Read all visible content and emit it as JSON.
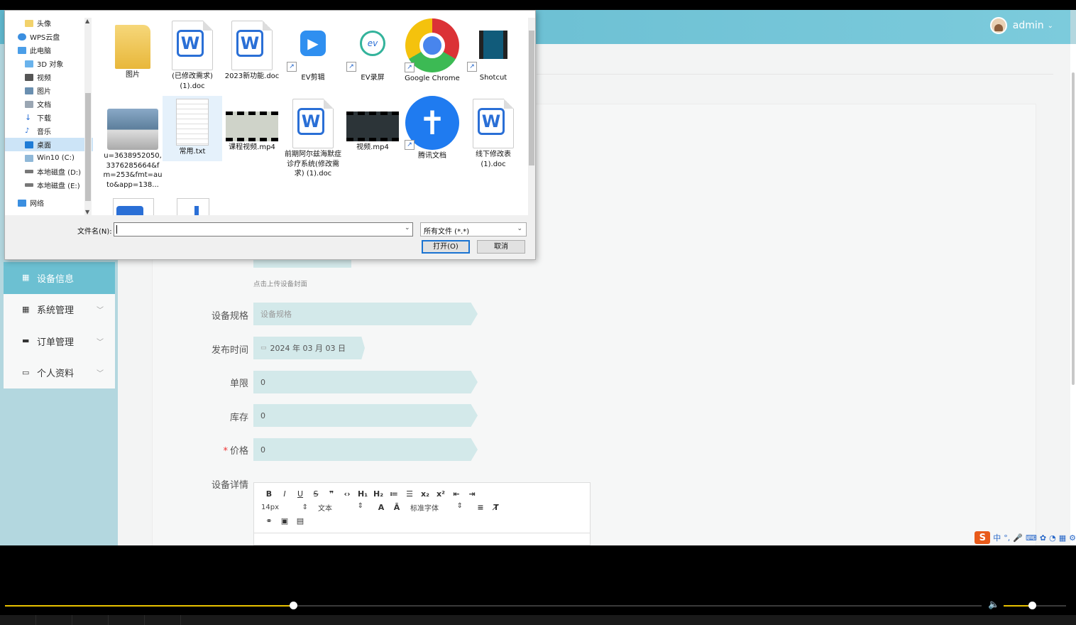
{
  "header": {
    "username": "admin"
  },
  "sidebar": {
    "items": [
      {
        "label": "设备信息",
        "active": true
      },
      {
        "label": "系统管理"
      },
      {
        "label": "订单管理"
      },
      {
        "label": "个人资料"
      }
    ]
  },
  "form": {
    "upload_hint": "点击上传设备封面",
    "spec_label": "设备规格",
    "spec_placeholder": "设备规格",
    "date_label": "发布时间",
    "date_value": "2024 年 03 月 03 日",
    "limit_label": "单限",
    "limit_value": "0",
    "stock_label": "库存",
    "stock_value": "0",
    "price_label": "价格",
    "price_value": "0",
    "detail_label": "设备详情",
    "editor": {
      "font_size": "14px",
      "block_type": "文本",
      "font_family": "标准字体"
    }
  },
  "dialog": {
    "nav": [
      {
        "label": "头像",
        "icon": "folder-icon"
      },
      {
        "label": "WPS云盘",
        "icon": "cloud-icon"
      },
      {
        "label": "此电脑",
        "icon": "computer-icon"
      },
      {
        "label": "3D 对象",
        "icon": "3d-icon"
      },
      {
        "label": "视频",
        "icon": "video-folder-icon"
      },
      {
        "label": "图片",
        "icon": "pictures-folder-icon"
      },
      {
        "label": "文档",
        "icon": "documents-folder-icon"
      },
      {
        "label": "下载",
        "icon": "download-icon"
      },
      {
        "label": "音乐",
        "icon": "music-icon"
      },
      {
        "label": "桌面",
        "icon": "desktop-icon",
        "selected": true
      },
      {
        "label": "Win10 (C:)",
        "icon": "drive-icon"
      },
      {
        "label": "本地磁盘 (D:)",
        "icon": "drive-icon"
      },
      {
        "label": "本地磁盘 (E:)",
        "icon": "drive-icon"
      },
      {
        "label": "网络",
        "icon": "network-icon"
      }
    ],
    "files": [
      {
        "name": "图片",
        "icon": "folder-icon"
      },
      {
        "name": "(已修改需求)(1).doc",
        "icon": "wps-doc-icon"
      },
      {
        "name": "2023新功能.doc",
        "icon": "wps-doc-icon"
      },
      {
        "name": "EV剪辑",
        "icon": "ev-clip-icon"
      },
      {
        "name": "EV录屏",
        "icon": "ev-record-icon"
      },
      {
        "name": "Google Chrome",
        "icon": "chrome-icon"
      },
      {
        "name": "Shotcut",
        "icon": "shotcut-icon"
      },
      {
        "name": "u=3638952050,3376285664&fm=253&fmt=auto&app=138...",
        "icon": "image-thumbnail-icon"
      },
      {
        "name": "常用.txt",
        "icon": "txt-icon",
        "selected": true
      },
      {
        "name": "课程视频.mp4",
        "icon": "video-thumbnail-icon"
      },
      {
        "name": "前期阿尔兹海默症诊疗系统(修改需求) (1).doc",
        "icon": "wps-doc-icon"
      },
      {
        "name": "视频.mp4",
        "icon": "video-thumbnail-icon"
      },
      {
        "name": "腾讯文档",
        "icon": "tencent-docs-icon"
      },
      {
        "name": "线下修改表(1).doc",
        "icon": "wps-doc-icon"
      }
    ],
    "filename_label": "文件名(N):",
    "filename_value": "",
    "filetype_value": "所有文件 (*.*)",
    "open_label": "打开(O)",
    "cancel_label": "取消"
  },
  "ime": {
    "logo": "S",
    "lang": "中"
  },
  "player": {
    "progress": 0.295,
    "volume": 0.45
  },
  "colors": {
    "accent": "#6cc0d2",
    "header": "#5fb6cc",
    "progress": "#e8c100"
  }
}
